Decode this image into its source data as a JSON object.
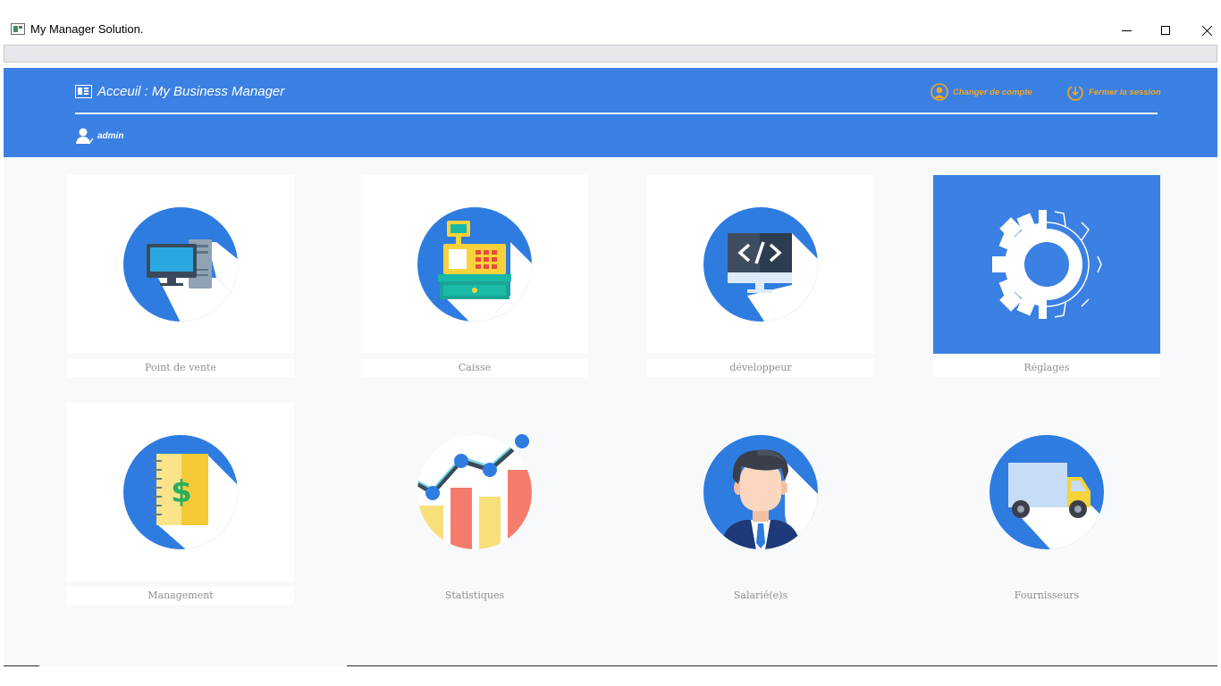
{
  "window": {
    "title": "My Manager Solution."
  },
  "header": {
    "title": "Acceuil : My Business Manager",
    "switch_account": "Changer de compte",
    "logout": "Fermer la session",
    "username": "admin"
  },
  "colors": {
    "header_bg": "#3b80e3",
    "link": "#f5a623",
    "tile_bg": "#ffffff",
    "main_bg": "#f8f9fa",
    "label": "#8f8f8f"
  },
  "tiles": [
    {
      "label": "Point de vente",
      "icon": "pos-computer-icon"
    },
    {
      "label": "Caisse",
      "icon": "cash-register-icon"
    },
    {
      "label": "développeur",
      "icon": "code-monitor-icon"
    },
    {
      "label": "Réglages",
      "icon": "gear-icon",
      "selected": true
    },
    {
      "label": "Management",
      "icon": "notebook-dollar-icon"
    },
    {
      "label": "Statistiques",
      "icon": "statistics-chart-icon"
    },
    {
      "label": "Salarié(e)s",
      "icon": "employee-icon"
    },
    {
      "label": "Fournisseurs",
      "icon": "delivery-truck-icon"
    }
  ]
}
